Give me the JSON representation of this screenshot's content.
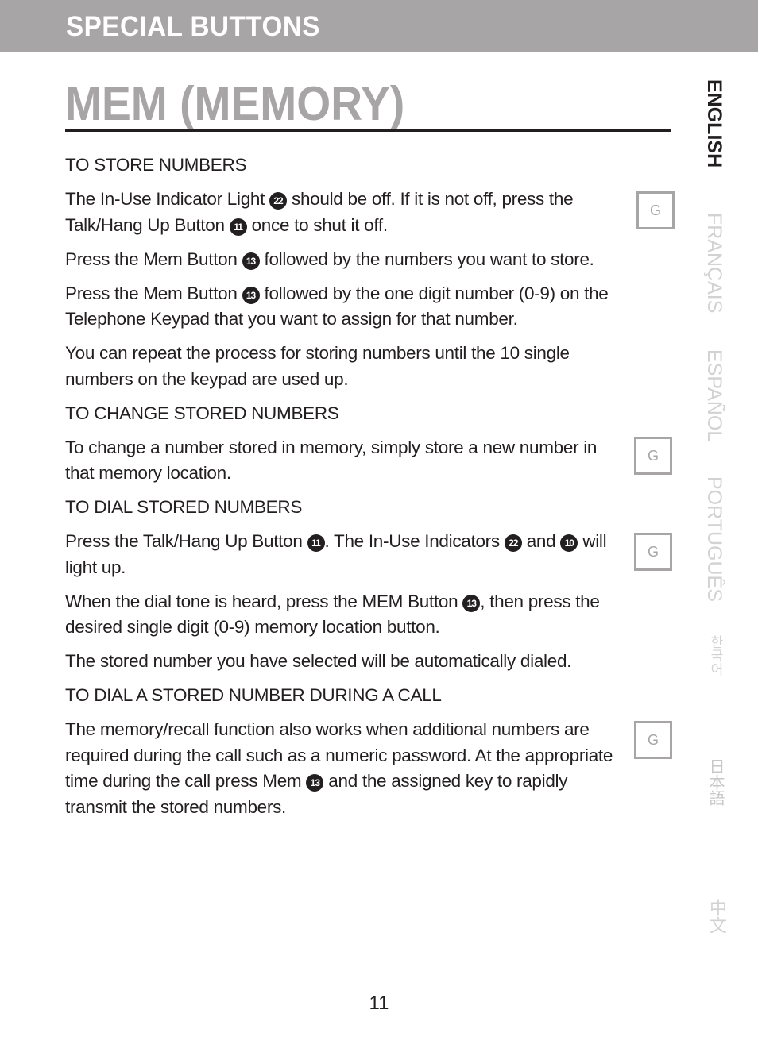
{
  "header": {
    "section_title": "SPECIAL BUTTONS"
  },
  "page_title": "MEM (MEMORY)",
  "content": {
    "store_heading": "TO STORE NUMBERS",
    "store_p1_a": "The In-Use Indicator Light ",
    "store_p1_ref1": "22",
    "store_p1_b": " should be off. If it is not off, press the Talk/Hang Up Button ",
    "store_p1_ref2": "11",
    "store_p1_c": " once to shut it off.",
    "store_p2_a": "Press the Mem Button ",
    "store_p2_ref": "13",
    "store_p2_b": " followed by the numbers you want to store.",
    "store_p3_a": "Press the Mem Button ",
    "store_p3_ref": "13",
    "store_p3_b": " followed by the one digit number (0-9) on the Telephone Keypad that you want to assign for that number.",
    "store_p4": "You can repeat the process for storing numbers until the 10 single numbers on the keypad are used up.",
    "change_heading": "TO CHANGE STORED NUMBERS",
    "change_p1": "To change a number stored in memory, simply store a new number in that memory location.",
    "dial_heading": "TO DIAL STORED NUMBERS",
    "dial_p1_a": "Press the Talk/Hang Up Button ",
    "dial_p1_ref1": "11",
    "dial_p1_b": ". The In-Use Indicators ",
    "dial_p1_ref2": "22",
    "dial_p1_c": " and ",
    "dial_p1_ref3": "10",
    "dial_p1_d": " will light up.",
    "dial_p2_a": "When the dial tone is heard, press the MEM Button ",
    "dial_p2_ref": "13",
    "dial_p2_b": ", then press the desired single digit (0-9) memory location button.",
    "dial_p3": "The stored number you have selected will be automatically dialed.",
    "during_heading": "TO DIAL A STORED NUMBER DURING A CALL",
    "during_p1_a": "The memory/recall function also works when additional numbers are required during the call such as a numeric password. At the appropriate time during the call press Mem ",
    "during_p1_ref": "13",
    "during_p1_b": " and the assigned key to rapidly transmit the stored numbers."
  },
  "margin_marks": {
    "label": "G"
  },
  "languages": [
    {
      "label": "ENGLISH",
      "active": true
    },
    {
      "label": "FRANÇAIS",
      "active": false
    },
    {
      "label": "ESPAÑOL",
      "active": false
    },
    {
      "label": "PORTUGUÊS",
      "active": false
    },
    {
      "label": "한국어",
      "active": false
    },
    {
      "label": "日本語",
      "active": false
    },
    {
      "label": "中文",
      "active": false
    }
  ],
  "page_number": "11"
}
